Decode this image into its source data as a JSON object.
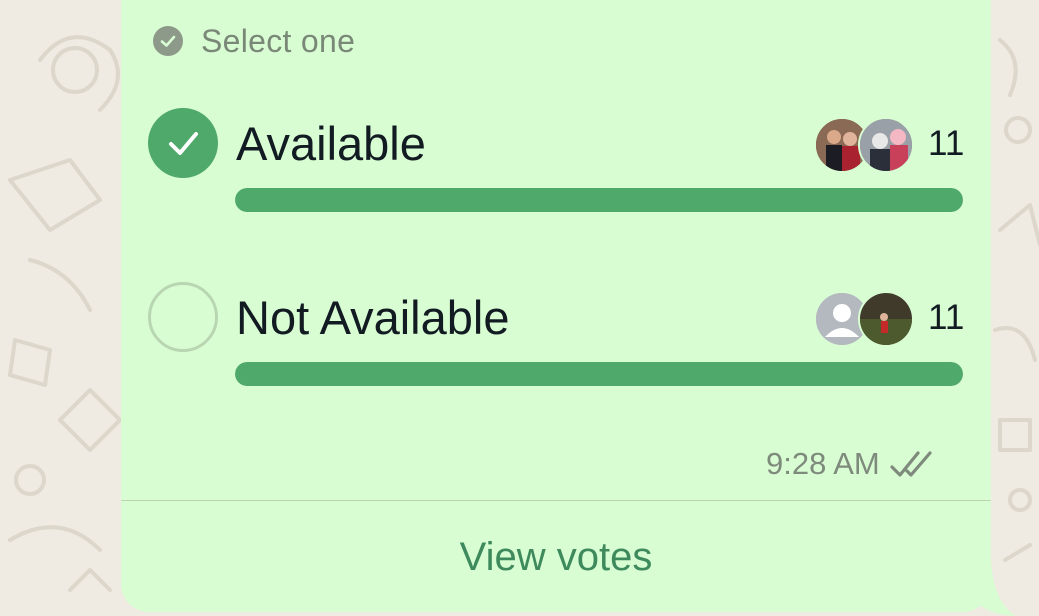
{
  "poll": {
    "select_label": "Select one",
    "options": [
      {
        "label": "Available",
        "votes": "11",
        "selected": true,
        "fill_fraction": 1.0
      },
      {
        "label": "Not Available",
        "votes": "11",
        "selected": false,
        "fill_fraction": 1.0
      }
    ],
    "time": "9:28 AM",
    "view_votes_label": "View votes"
  },
  "colors": {
    "bubble": "#d9fdd3",
    "accent": "#4fa96a",
    "wallpaper": "#efeae2",
    "link": "#3f8a5c"
  },
  "icons": {
    "select_check": "check-circle-icon",
    "selected_radio": "checkmark-icon",
    "read_receipt": "double-check-icon"
  }
}
